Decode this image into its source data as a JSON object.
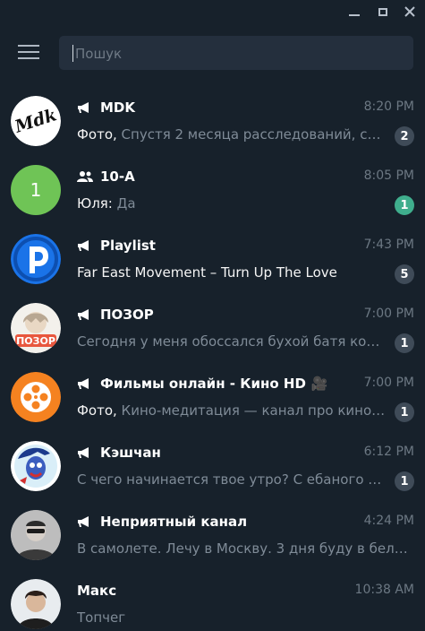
{
  "search": {
    "placeholder": "Пошук"
  },
  "chats": [
    {
      "name": "MDK",
      "time": "8:20 PM",
      "media": "Фото, ",
      "text": "Спустя 2 месяца расследований, суд…",
      "unread": "2",
      "type_icon": "megaphone-icon",
      "avatar_icon": "mdk-logo"
    },
    {
      "name": "10-А",
      "time": "8:05 PM",
      "sender": "Юля: ",
      "text": "Да",
      "unread": "1",
      "type_icon": "group-icon",
      "avatar_letter": "1",
      "avatar_color": "#6fc456"
    },
    {
      "name": "Playlist",
      "time": "7:43 PM",
      "text": "Far East Movement – Turn Up The Love",
      "unread": "5",
      "type_icon": "megaphone-icon",
      "avatar_icon": "playlist-logo"
    },
    {
      "name": "ПОЗОР",
      "time": "7:00 PM",
      "text": "Сегодня у меня обоссался бухой батя когд…",
      "unread": "1",
      "type_icon": "megaphone-icon",
      "avatar_icon": "pozor-logo"
    },
    {
      "name": "Фильмы онлайн - Кино HD",
      "emoji": "🎥",
      "time": "7:00 PM",
      "media": "Фото, ",
      "text": "Кино-медитация — канал про кино и…",
      "unread": "1",
      "type_icon": "megaphone-icon",
      "avatar_icon": "film-reel-logo"
    },
    {
      "name": "Кэшчан",
      "time": "6:12 PM",
      "text": "С чего начинается твое утро? С ебаного оп…",
      "unread": "1",
      "type_icon": "megaphone-icon",
      "avatar_icon": "cashchan-logo"
    },
    {
      "name": "Неприятный канал",
      "time": "4:24 PM",
      "text": "В самолете. Лечу в Москву. 3 дня буду в белока…",
      "unread": "",
      "type_icon": "megaphone-icon",
      "avatar_icon": "person-photo"
    },
    {
      "name": "Макс",
      "time": "10:38 AM",
      "text": "Топчег",
      "unread": "",
      "type_icon": "",
      "avatar_icon": "person-photo"
    }
  ]
}
